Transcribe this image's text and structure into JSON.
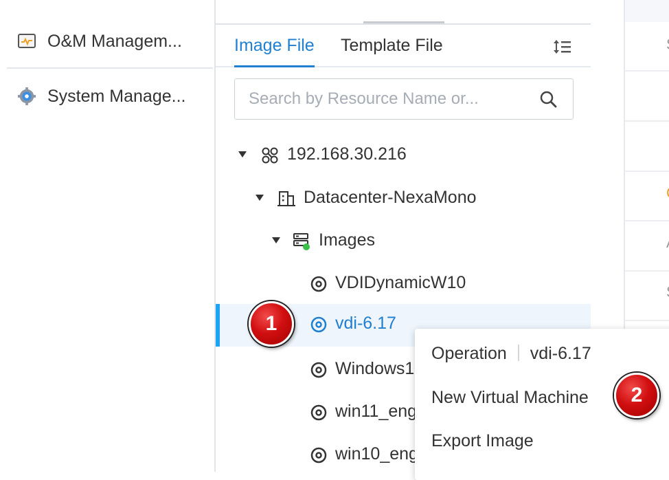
{
  "nav": {
    "items": [
      {
        "label": "O&M Managem...",
        "icon": "monitor-icon"
      },
      {
        "label": "System Manage...",
        "icon": "gear-icon"
      }
    ]
  },
  "tabs": [
    {
      "label": "Image File",
      "active": true
    },
    {
      "label": "Template File",
      "active": false
    }
  ],
  "search": {
    "placeholder": "Search by Resource Name or...",
    "value": ""
  },
  "tree": [
    {
      "label": "192.168.30.216",
      "icon": "cluster-icon",
      "expanded": true,
      "level": 0
    },
    {
      "label": "Datacenter-NexaMono",
      "icon": "datacenter-icon",
      "expanded": true,
      "level": 1
    },
    {
      "label": "Images",
      "icon": "storage-icon",
      "expanded": true,
      "level": 2
    },
    {
      "label": "VDIDynamicW10",
      "icon": "disc-icon",
      "level": 3
    },
    {
      "label": "vdi-6.17",
      "icon": "disc-icon",
      "level": 3,
      "selected": true
    },
    {
      "label": "Windows1",
      "icon": "disc-icon",
      "level": 3
    },
    {
      "label": "win11_eng",
      "icon": "disc-icon",
      "level": 3
    },
    {
      "label": "win10_eng",
      "icon": "disc-icon",
      "level": 3
    }
  ],
  "context_menu": {
    "header_label": "Operation",
    "header_target": "vdi-6.17",
    "items": [
      {
        "label": "New Virtual Machine"
      },
      {
        "label": "Export Image"
      }
    ]
  },
  "steps": [
    {
      "label": "1"
    },
    {
      "label": "2"
    }
  ],
  "right_fragments": [
    "S",
    "C",
    "A",
    "S"
  ],
  "colors": {
    "accent": "#1f7fd1",
    "selection_bar": "#1fa3f5",
    "badge": "#d10f10",
    "status_green": "#3cc24a"
  }
}
